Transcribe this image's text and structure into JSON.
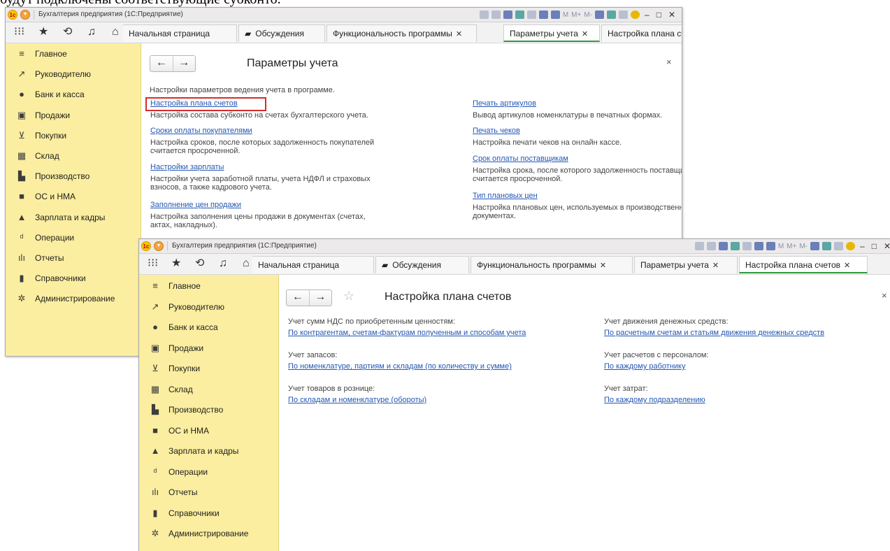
{
  "document_text": "будут подключены соответствующие субконто.",
  "windows": {
    "back": {
      "title": "Бухгалтерия предприятия (1С:Предприятие)",
      "tabs": [
        {
          "label": "Начальная страница",
          "closable": false
        },
        {
          "label": "Обсуждения",
          "closable": false
        },
        {
          "label": "Функциональность программы",
          "closable": true
        },
        {
          "label": "Параметры учета",
          "closable": true,
          "active": true
        },
        {
          "label": "Настройка плана счетов",
          "closable": true
        }
      ],
      "page_title": "Параметры учета",
      "intro": "Настройки параметров ведения учета в программе.",
      "left_items": [
        {
          "link": "Настройка плана счетов",
          "desc": [
            "Настройка состава субконто на счетах бухгалтерского учета."
          ],
          "highlighted": true
        },
        {
          "link": "Сроки оплаты покупателями",
          "desc": [
            "Настройка сроков, после которых задолженность покупателей",
            "считается просроченной."
          ]
        },
        {
          "link": "Настройки зарплаты",
          "desc": [
            "Настройки учета заработной платы, учета НДФЛ и страховых",
            "взносов, а также кадрового учета."
          ]
        },
        {
          "link": "Заполнение цен продажи",
          "desc": [
            "Настройка заполнения цены продажи в документах (счетах,",
            "актах, накладных)."
          ]
        }
      ],
      "right_items": [
        {
          "link": "Печать артикулов",
          "desc": [
            "Вывод артикулов номенклатуры в печатных формах."
          ]
        },
        {
          "link": "Печать чеков",
          "desc": [
            "Настройка печати чеков на онлайн кассе."
          ]
        },
        {
          "link": "Срок оплаты поставщикам",
          "desc": [
            "Настройка срока, после которого задолженность поставщикам",
            "считается просроченной."
          ]
        },
        {
          "link": "Тип плановых цен",
          "desc": [
            "Настройка плановых цен, используемых в производственных",
            "документах."
          ]
        }
      ]
    },
    "front": {
      "title": "Бухгалтерия предприятия (1С:Предприятие)",
      "tabs": [
        {
          "label": "Начальная страница",
          "closable": false
        },
        {
          "label": "Обсуждения",
          "closable": false
        },
        {
          "label": "Функциональность программы",
          "closable": true
        },
        {
          "label": "Параметры учета",
          "closable": true
        },
        {
          "label": "Настройка плана счетов",
          "closable": true,
          "active": true
        }
      ],
      "page_title": "Настройка плана счетов",
      "settings": [
        {
          "label": "Учет сумм НДС по приобретенным ценностям:",
          "value": "По контрагентам, счетам-фактурам полученным и способам учета"
        },
        {
          "label": "Учет запасов:",
          "value": "По номенклатуре, партиям и складам (по количеству и сумме)"
        },
        {
          "label": "Учет товаров в рознице:",
          "value": "По складам и номенклатуре (обороты)"
        },
        {
          "label": "Учет движения денежных средств:",
          "value": "По расчетным счетам и статьям движения денежных средств"
        },
        {
          "label": "Учет расчетов с персоналом:",
          "value": "По каждому работнику"
        },
        {
          "label": "Учет затрат:",
          "value": "По каждому подразделению"
        }
      ]
    }
  },
  "sidebar": [
    {
      "label": "Главное",
      "icon": "menu-icon"
    },
    {
      "label": "Руководителю",
      "icon": "trend-icon"
    },
    {
      "label": "Банк и касса",
      "icon": "coin-icon"
    },
    {
      "label": "Продажи",
      "icon": "bag-icon"
    },
    {
      "label": "Покупки",
      "icon": "cart-icon"
    },
    {
      "label": "Склад",
      "icon": "warehouse-icon"
    },
    {
      "label": "Производство",
      "icon": "factory-icon"
    },
    {
      "label": "ОС и НМА",
      "icon": "truck-icon"
    },
    {
      "label": "Зарплата и кадры",
      "icon": "person-icon"
    },
    {
      "label": "Операции",
      "icon": "dt-kt-icon"
    },
    {
      "label": "Отчеты",
      "icon": "bar-chart-icon"
    },
    {
      "label": "Справочники",
      "icon": "book-icon"
    },
    {
      "label": "Администрирование",
      "icon": "gear-icon"
    }
  ],
  "toolbar_text": {
    "m": "M",
    "mplus": "M+",
    "mminus": "M-",
    "min": "–",
    "max": "□",
    "close": "✕"
  },
  "close_x": "×",
  "nav_back": "←",
  "nav_fwd": "→",
  "star": "☆"
}
